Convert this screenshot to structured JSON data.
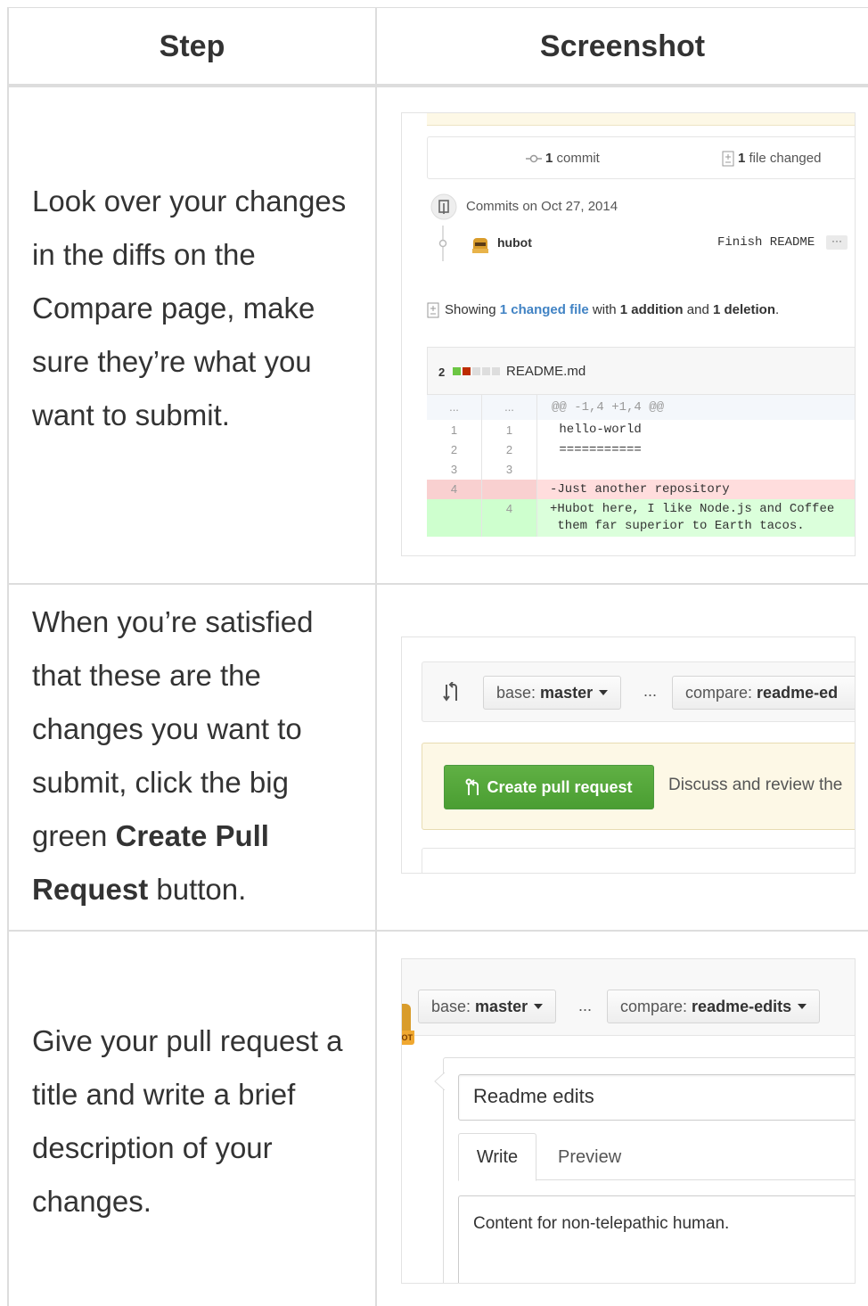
{
  "table": {
    "headers": {
      "step": "Step",
      "screenshot": "Screenshot"
    },
    "rows": [
      {
        "step_text": "Look over your changes in the diffs on the Compare page, make sure they’re what you want to submit."
      },
      {
        "step_text_before": "When you’re satisfied that these are the changes you want to submit, click the big green ",
        "step_text_bold1": "Create Pull",
        "step_text_bold2": "Request",
        "step_text_after": " button."
      },
      {
        "step_text": "Give your pull request a title and write a brief description of your changes."
      }
    ]
  },
  "shot1": {
    "commits_count": "1",
    "commits_label": "commit",
    "files_count": "1",
    "files_label": "file changed",
    "commits_on": "Commits on Oct 27, 2014",
    "author": "hubot",
    "commit_message": "Finish README",
    "ellipsis": "···",
    "showing_prefix": "Showing ",
    "showing_link": "1 changed file",
    "showing_with": " with ",
    "additions": "1 addition",
    "showing_and": " and ",
    "deletions": "1 deletion",
    "showing_end": ".",
    "file_diff_count": "2",
    "file_name": "README.md",
    "diff_lines": [
      {
        "old": "...",
        "new": "...",
        "code": "@@ -1,4 +1,4 @@",
        "kind": "hunk"
      },
      {
        "old": "1",
        "new": "1",
        "code": " hello-world",
        "kind": "ctx"
      },
      {
        "old": "2",
        "new": "2",
        "code": " ===========",
        "kind": "ctx"
      },
      {
        "old": "3",
        "new": "3",
        "code": " ",
        "kind": "ctx"
      },
      {
        "old": "4",
        "new": "",
        "code": "-Just another repository",
        "kind": "del"
      },
      {
        "old": "",
        "new": "4",
        "code": "+Hubot here, I like Node.js and Coffee",
        "kind": "add"
      },
      {
        "old": "",
        "new": "",
        "code": " them far superior to Earth tacos.",
        "kind": "add"
      }
    ],
    "colors": {
      "del_bg": "#ffdddd",
      "add_bg": "#dbffdb",
      "hunk_bg": "#f4f7fb",
      "link": "#4183c4"
    }
  },
  "shot2": {
    "base_label": "base:",
    "base_branch": "master",
    "separator": "...",
    "compare_label": "compare:",
    "compare_branch": "readme-ed",
    "create_button": "Create pull request",
    "discuss_text": "Discuss and review the"
  },
  "shot3": {
    "base_label": "base:",
    "base_branch": "master",
    "separator": "...",
    "compare_label": "compare:",
    "compare_branch": "readme-edits",
    "title_value": "Readme edits",
    "tab_write": "Write",
    "tab_preview": "Preview",
    "body_value": "Content for non-telepathic human.",
    "avatar_text": "OT"
  },
  "icons": [
    "commit-icon",
    "file-diff-icon",
    "repo-push-icon",
    "hubot-avatar-icon",
    "compare-arrows-icon",
    "pull-request-icon",
    "caret-down-icon"
  ]
}
